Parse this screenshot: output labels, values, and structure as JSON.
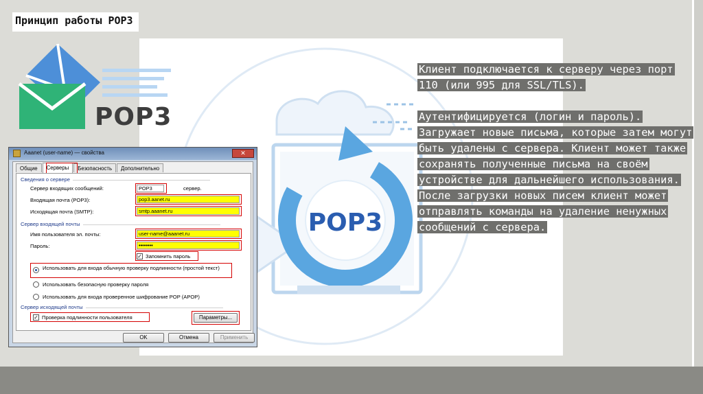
{
  "slide": {
    "title": "Принцип работы POP3"
  },
  "logo": {
    "text": "POP3"
  },
  "illustration": {
    "center_text": "POP3"
  },
  "description": {
    "paragraph1": "Клиент подключается к серверу через порт 110 (или 995 для SSL/TLS).",
    "paragraph2": "Аутентифицируется (логин и пароль). Загружает новые письма, которые затем могут быть удалены с сервера. Клиент может также сохранять полученные письма на своём устройстве для дальнейшего использования. После загрузки новых писем клиент может отправлять команды на удаление ненужных сообщений с сервера."
  },
  "dialog": {
    "title": "Aaanet (user-name) — свойства",
    "close_label": "✕",
    "tabs": [
      "Общие",
      "Серверы",
      "Безопасность",
      "Дополнительно"
    ],
    "server_info_group": "Сведения о сервере",
    "incoming_server_label": "Сервер входящих сообщений:",
    "incoming_server_value": "POP3",
    "incoming_server_suffix": "сервер.",
    "incoming_mail_label": "Входящая почта (POP3):",
    "incoming_mail_value": "pop3.aanet.ru",
    "outgoing_mail_label": "Исходящая почта (SMTP):",
    "outgoing_mail_value": "smtp.aaanet.ru",
    "incoming_group": "Сервер входящей почты",
    "username_label": "Имя пользователя эл. почты:",
    "username_value": "user-name@aaanet.ru",
    "password_label": "Пароль:",
    "password_value": "••••••••",
    "remember_label": "Запомнить пароль",
    "radio1_label": "Использовать для входа обычную проверку подлинности (простой текст)",
    "radio2_label": "Использовать безопасную проверку пароля",
    "radio3_label": "Использовать для входа проверенное шифрование POP (APOP)",
    "outgoing_group": "Сервер исходящей почты",
    "auth_label": "Проверка подлинности пользователя",
    "params_button": "Параметры...",
    "ok_button": "OK",
    "cancel_button": "Отмена",
    "apply_button": "Применить"
  },
  "colors": {
    "envelope_blue": "#4d8fd8",
    "envelope_green": "#2fb377",
    "cycle_blue": "#5aa6e0",
    "highlight_gray": "#6f6f6c"
  }
}
